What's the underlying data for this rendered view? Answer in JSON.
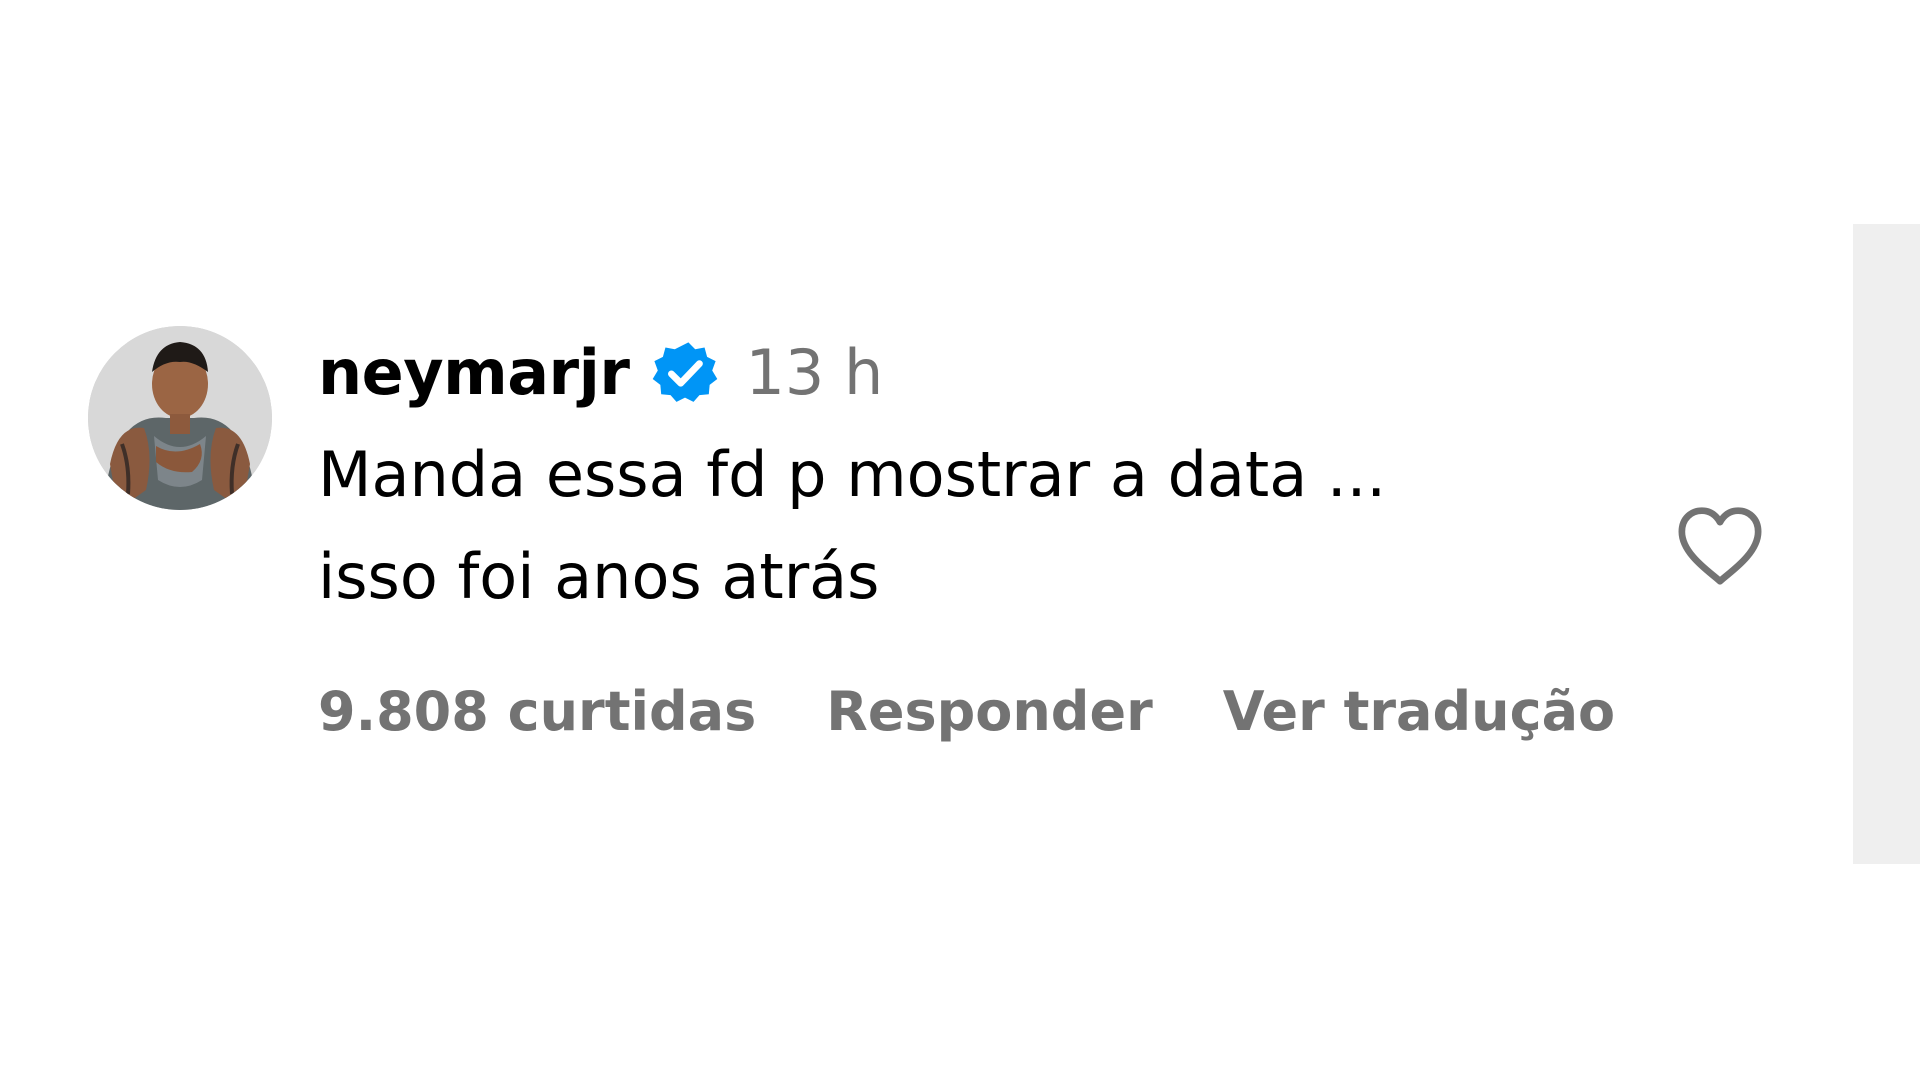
{
  "comment": {
    "username": "neymarjr",
    "verified_icon": "verified-badge-icon",
    "timestamp": "13 h",
    "text_lines": [
      "Manda essa fd p mostrar a data ...",
      "isso foi anos atrás"
    ],
    "likes": "9.808 curtidas",
    "reply_label": "Responder",
    "translate_label": "Ver tradução",
    "like_icon": "heart-outline-icon",
    "avatar_icon": "profile-avatar"
  },
  "colors": {
    "text": "#000000",
    "secondary": "#737373",
    "verified": "#0095f6",
    "scroll_track": "#efefef"
  }
}
